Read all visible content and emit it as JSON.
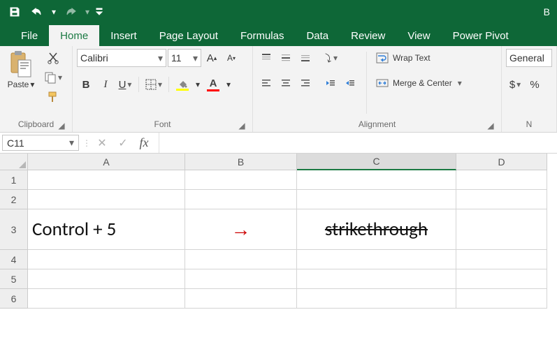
{
  "title_right": "B",
  "tabs": [
    "File",
    "Home",
    "Insert",
    "Page Layout",
    "Formulas",
    "Data",
    "Review",
    "View",
    "Power Pivot"
  ],
  "active_tab_index": 1,
  "clipboard": {
    "paste_label": "Paste",
    "group_label": "Clipboard"
  },
  "font": {
    "family": "Calibri",
    "size": "11",
    "group_label": "Font",
    "bold": "B",
    "italic": "I",
    "underline": "U"
  },
  "alignment": {
    "wrap_label": "Wrap Text",
    "merge_label": "Merge & Center",
    "group_label": "Alignment"
  },
  "number": {
    "format": "General",
    "group_label": "N",
    "currency": "$",
    "percent": "%"
  },
  "namebox": "C11",
  "fx_label": "fx",
  "formula_value": "",
  "columns": [
    "A",
    "B",
    "C",
    "D"
  ],
  "selected_col_index": 2,
  "rows": [
    "1",
    "2",
    "3",
    "4",
    "5",
    "6"
  ],
  "tall_row_index": 2,
  "sheet": {
    "A3": "Control + 5",
    "B3_arrow": "→",
    "C3": "strikethrough"
  }
}
